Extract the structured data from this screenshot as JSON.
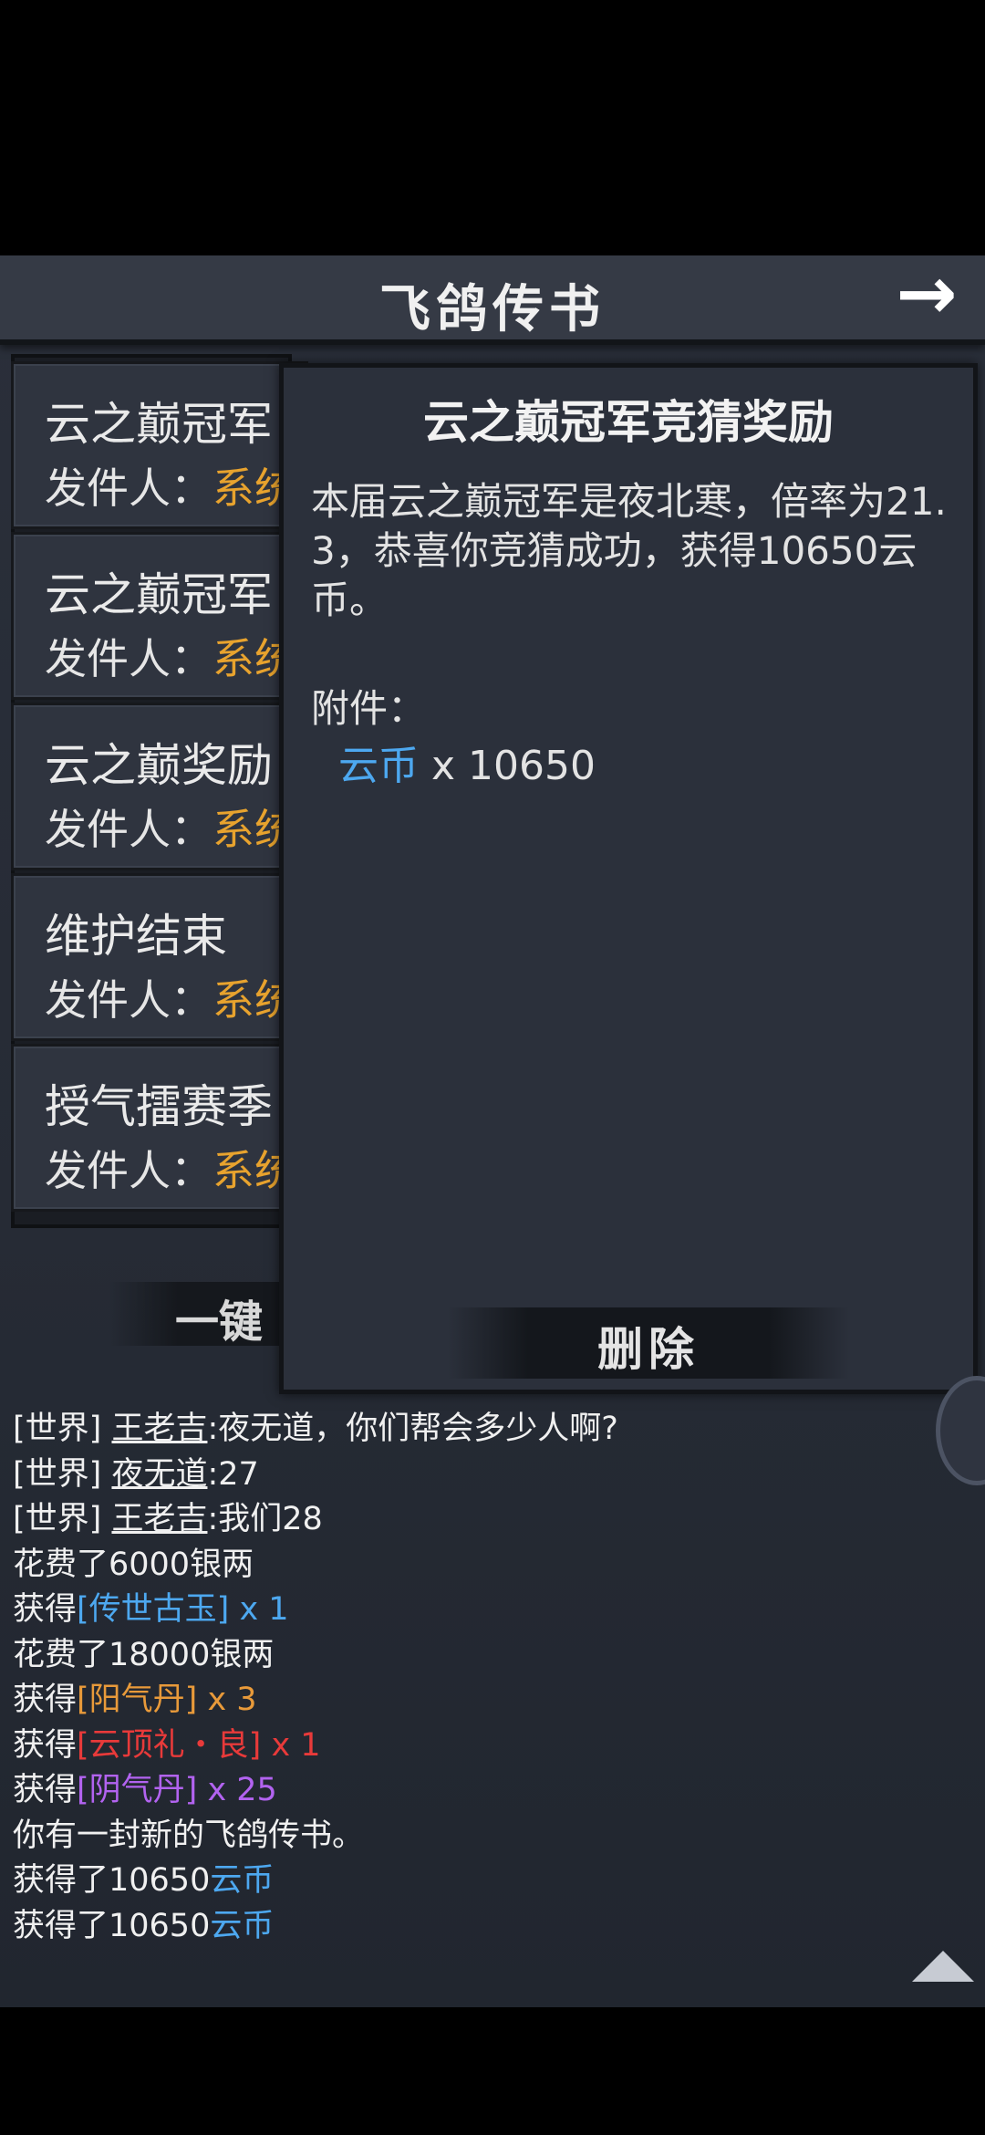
{
  "header": {
    "title": "飞鸽传书",
    "back_icon": "→"
  },
  "mail_list": {
    "items": [
      {
        "subject": "云之巅冠军",
        "sender_prefix": "发件人：",
        "sender": "系统"
      },
      {
        "subject": "云之巅冠军",
        "sender_prefix": "发件人：",
        "sender": "系统"
      },
      {
        "subject": "云之巅奖励",
        "sender_prefix": "发件人：",
        "sender": "系统"
      },
      {
        "subject": "维护结束",
        "sender_prefix": "发件人：",
        "sender": "系统"
      },
      {
        "subject": "授气擂赛季",
        "sender_prefix": "发件人：",
        "sender": "系统"
      }
    ],
    "bulk_label": "一键"
  },
  "detail": {
    "title": "云之巅冠军竞猜奖励",
    "body": "本届云之巅冠军是夜北寒，倍率为21.3，恭喜你竞猜成功，获得10650云币。",
    "attach_label": "附件：",
    "attachment": {
      "name": "云币",
      "qty": " x 10650"
    },
    "delete_label": "删除"
  },
  "chat": [
    {
      "tag": "[世界]",
      "speaker": "王老吉",
      "text": ":夜无道，你们帮会多少人啊?"
    },
    {
      "tag": "[世界]",
      "speaker": "夜无道",
      "text": ":27"
    },
    {
      "tag": "[世界]",
      "speaker": "王老吉",
      "text": ":我们28"
    },
    {
      "pre": "花费了6000",
      "post": "银两"
    },
    {
      "pre": "获得",
      "item": "[传世古玉]",
      "qty": " x 1",
      "color": "blue"
    },
    {
      "pre": "花费了18000",
      "post": "银两"
    },
    {
      "pre": "获得",
      "item": "[阳气丹]",
      "qty": " x 3",
      "color": "orange"
    },
    {
      "pre": "获得",
      "item": "[云顶礼・良]",
      "qty": " x 1",
      "color": "red"
    },
    {
      "pre": "获得",
      "item": "[阴气丹]",
      "qty": " x 25",
      "color": "purple"
    },
    {
      "pre": "你有一封新的飞鸽传书。"
    },
    {
      "pre": "获得了10650",
      "item": "云币",
      "color": "blue"
    },
    {
      "pre": "获得了10650",
      "item": "云币",
      "color": "blue"
    }
  ],
  "colors": {
    "system_sender": "#e8a32e",
    "item_blue": "#4da8f0",
    "item_orange": "#e89a3a",
    "item_red": "#e83a3a",
    "item_purple": "#b263f0"
  }
}
